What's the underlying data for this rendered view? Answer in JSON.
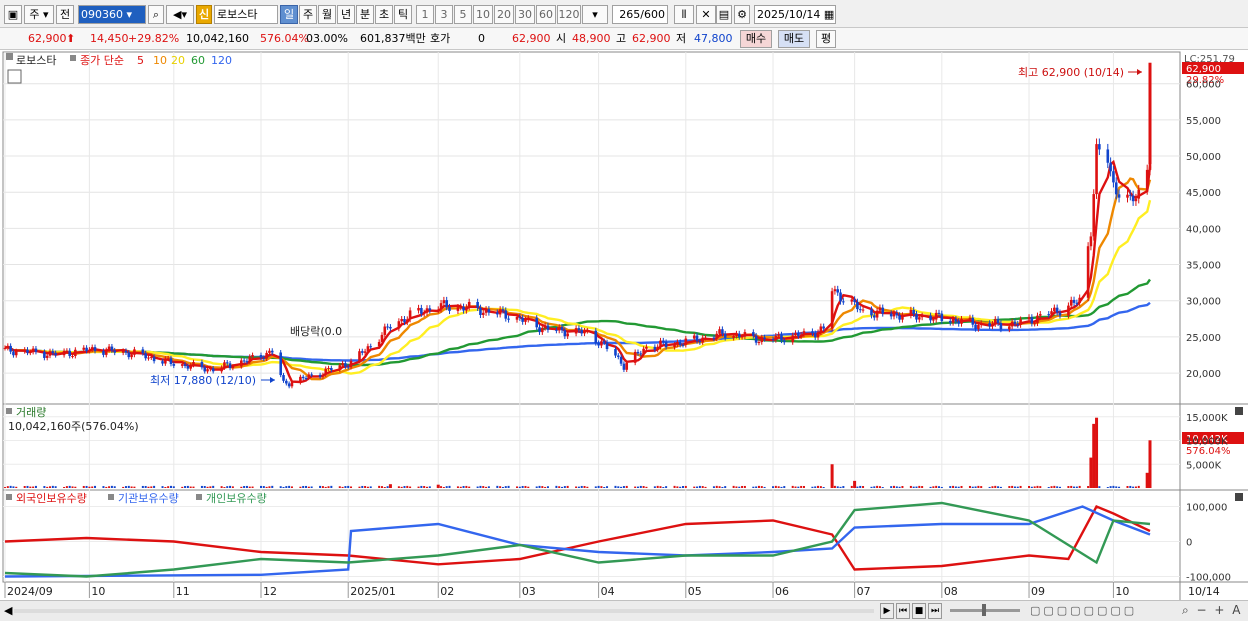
{
  "toolbar": {
    "market": "주",
    "prev_label": "전",
    "code": "090360",
    "new_badge": "신",
    "name": "로보스타",
    "periods": [
      "일",
      "주",
      "월",
      "년",
      "분",
      "초",
      "틱"
    ],
    "active_period": "일",
    "intervals": [
      "1",
      "3",
      "5",
      "10",
      "20",
      "30",
      "60",
      "120"
    ],
    "count": "265",
    "count_max": "/600",
    "date": "2025/10/14"
  },
  "quote": {
    "price": "62,900",
    "change": "14,450",
    "change_pct": "+29.82%",
    "volume": "10,042,160",
    "volume_ratio": "576.04%",
    "turnover_pct": "03.00%",
    "amount": "601,837백만",
    "hoga_label": "호가",
    "hoga_value": "0",
    "ask": "62,900",
    "open_label": "시",
    "open": "48,900",
    "high_label": "고",
    "high": "62,900",
    "low_label": "저",
    "low": "47,800",
    "buy_label": "매수",
    "sell_label": "매도",
    "avg_label": "평"
  },
  "colors": {
    "up": "#dd1111",
    "down": "#1144cc",
    "ma5": "#dd1111",
    "ma10": "#ee8800",
    "ma20": "#ffee22",
    "ma60": "#229933",
    "ma120": "#3366ee",
    "foreign": "#dd1111",
    "institution": "#3366ee",
    "individual": "#339955"
  },
  "chart_data": [
    {
      "type": "candlestick",
      "legend": {
        "stock_name": "로보스타",
        "indicator_label": "종가 단순",
        "periods": [
          "5",
          "10",
          "20",
          "60",
          "120"
        ]
      },
      "ylim": [
        16000,
        63000
      ],
      "yticks": [
        20000,
        25000,
        30000,
        35000,
        40000,
        45000,
        50000,
        55000,
        60000
      ],
      "ytick_labels": [
        "20,000",
        "25,000",
        "30,000",
        "35,000",
        "40,000",
        "45,000",
        "50,000",
        "55,000",
        "60,000"
      ],
      "xticks": [
        {
          "label": "2024/09",
          "date": "2024-09-02"
        },
        {
          "label": "10",
          "date": "2024-10-02"
        },
        {
          "label": "11",
          "date": "2024-11-01"
        },
        {
          "label": "12",
          "date": "2024-12-02"
        },
        {
          "label": "2025/01",
          "date": "2025-01-02"
        },
        {
          "label": "02",
          "date": "2025-02-03"
        },
        {
          "label": "03",
          "date": "2025-03-04"
        },
        {
          "label": "04",
          "date": "2025-04-01"
        },
        {
          "label": "05",
          "date": "2025-05-02"
        },
        {
          "label": "06",
          "date": "2025-06-02"
        },
        {
          "label": "07",
          "date": "2025-07-01"
        },
        {
          "label": "08",
          "date": "2025-08-01"
        },
        {
          "label": "09",
          "date": "2025-09-01"
        },
        {
          "label": "10",
          "date": "2025-10-01"
        },
        {
          "label": "10/14",
          "date": "2025-10-14"
        }
      ],
      "close_series": [
        {
          "date": "2024-09-02",
          "close": 23200
        },
        {
          "date": "2024-09-20",
          "close": 22600
        },
        {
          "date": "2024-10-04",
          "close": 23300
        },
        {
          "date": "2024-10-18",
          "close": 22700
        },
        {
          "date": "2024-11-01",
          "close": 21300
        },
        {
          "date": "2024-11-15",
          "close": 20500
        },
        {
          "date": "2024-11-29",
          "close": 22000
        },
        {
          "date": "2024-12-06",
          "close": 23000
        },
        {
          "date": "2024-12-10",
          "close": 18500
        },
        {
          "date": "2024-12-20",
          "close": 19600
        },
        {
          "date": "2025-01-03",
          "close": 21500
        },
        {
          "date": "2025-01-10",
          "close": 23800
        },
        {
          "date": "2025-01-17",
          "close": 26500
        },
        {
          "date": "2025-01-24",
          "close": 28000
        },
        {
          "date": "2025-02-03",
          "close": 29300
        },
        {
          "date": "2025-02-14",
          "close": 29000
        },
        {
          "date": "2025-02-28",
          "close": 28000
        },
        {
          "date": "2025-03-14",
          "close": 26000
        },
        {
          "date": "2025-03-28",
          "close": 25600
        },
        {
          "date": "2025-04-07",
          "close": 22500
        },
        {
          "date": "2025-04-10",
          "close": 21000
        },
        {
          "date": "2025-04-18",
          "close": 23600
        },
        {
          "date": "2025-05-02",
          "close": 24300
        },
        {
          "date": "2025-05-16",
          "close": 25500
        },
        {
          "date": "2025-05-30",
          "close": 24600
        },
        {
          "date": "2025-06-13",
          "close": 25300
        },
        {
          "date": "2025-06-20",
          "close": 26000
        },
        {
          "date": "2025-06-23",
          "close": 31500
        },
        {
          "date": "2025-07-04",
          "close": 28500
        },
        {
          "date": "2025-07-18",
          "close": 28000
        },
        {
          "date": "2025-08-01",
          "close": 27600
        },
        {
          "date": "2025-08-14",
          "close": 26700
        },
        {
          "date": "2025-08-28",
          "close": 26800
        },
        {
          "date": "2025-09-05",
          "close": 27800
        },
        {
          "date": "2025-09-12",
          "close": 28800
        },
        {
          "date": "2025-09-19",
          "close": 30000
        },
        {
          "date": "2025-09-23",
          "close": 40000
        },
        {
          "date": "2025-09-25",
          "close": 50500
        },
        {
          "date": "2025-09-29",
          "close": 49500
        },
        {
          "date": "2025-10-01",
          "close": 46000
        },
        {
          "date": "2025-10-07",
          "close": 43500
        },
        {
          "date": "2025-10-10",
          "close": 45000
        },
        {
          "date": "2025-10-13",
          "close": 48450
        },
        {
          "date": "2025-10-14",
          "close": 62900
        }
      ],
      "annotations": {
        "high": {
          "text": "최고 62,900 (10/14)",
          "date": "2025-10-14",
          "value": 62900
        },
        "low": {
          "text": "최저 17,880 (12/10)",
          "date": "2024-12-10",
          "value": 17880
        },
        "dividend": {
          "text": "배당락(0.0",
          "date": "2024-12-27"
        }
      },
      "right_labels": {
        "lc": "LC:251.79",
        "price": "62,900",
        "pct": "29.82%"
      }
    },
    {
      "type": "bar",
      "title": "거래량",
      "subtitle": "10,042,160주(576.04%)",
      "ylim": [
        0,
        16000000
      ],
      "yticks": [
        5000000,
        10000000,
        15000000
      ],
      "ytick_labels": [
        "5,000K",
        "10,000K",
        "15,000K"
      ],
      "bars": [
        {
          "date": "2025-01-17",
          "value": 800000,
          "dir": "up"
        },
        {
          "date": "2025-02-03",
          "value": 700000,
          "dir": "up"
        },
        {
          "date": "2025-06-23",
          "value": 5000000,
          "dir": "up"
        },
        {
          "date": "2025-07-01",
          "value": 1500000,
          "dir": "up"
        },
        {
          "date": "2025-09-23",
          "value": 6400000,
          "dir": "up"
        },
        {
          "date": "2025-09-24",
          "value": 13500000,
          "dir": "up"
        },
        {
          "date": "2025-09-25",
          "value": 14800000,
          "dir": "up"
        },
        {
          "date": "2025-10-13",
          "value": 3200000,
          "dir": "up"
        },
        {
          "date": "2025-10-14",
          "value": 10042160,
          "dir": "up"
        }
      ],
      "right_labels": {
        "value": "10,042K",
        "pct": "576.04%"
      }
    },
    {
      "type": "line",
      "legend": [
        "외국인보유수량",
        "기관보유수량",
        "개인보유수량"
      ],
      "ylim": [
        -110000,
        130000
      ],
      "yticks": [
        -100000,
        0,
        100000
      ],
      "ytick_labels": [
        "-100,000",
        "0",
        "100,000"
      ],
      "series": [
        {
          "name": "외국인보유수량",
          "points": [
            [
              "2024-09-02",
              0
            ],
            [
              "2024-10-01",
              10000
            ],
            [
              "2024-11-01",
              0
            ],
            [
              "2024-12-02",
              -30000
            ],
            [
              "2025-01-02",
              -40000
            ],
            [
              "2025-02-03",
              -65000
            ],
            [
              "2025-03-04",
              -50000
            ],
            [
              "2025-04-01",
              0
            ],
            [
              "2025-05-02",
              50000
            ],
            [
              "2025-06-02",
              60000
            ],
            [
              "2025-06-23",
              20000
            ],
            [
              "2025-07-01",
              -80000
            ],
            [
              "2025-08-01",
              -70000
            ],
            [
              "2025-09-01",
              -40000
            ],
            [
              "2025-09-15",
              -50000
            ],
            [
              "2025-09-25",
              100000
            ],
            [
              "2025-10-01",
              80000
            ],
            [
              "2025-10-14",
              30000
            ]
          ]
        },
        {
          "name": "기관보유수량",
          "points": [
            [
              "2024-09-02",
              -100000
            ],
            [
              "2024-12-02",
              -95000
            ],
            [
              "2025-01-02",
              -80000
            ],
            [
              "2025-01-03",
              30000
            ],
            [
              "2025-02-03",
              50000
            ],
            [
              "2025-03-04",
              -10000
            ],
            [
              "2025-04-01",
              -30000
            ],
            [
              "2025-05-02",
              -40000
            ],
            [
              "2025-06-02",
              -30000
            ],
            [
              "2025-06-23",
              -20000
            ],
            [
              "2025-07-01",
              40000
            ],
            [
              "2025-08-01",
              50000
            ],
            [
              "2025-09-01",
              50000
            ],
            [
              "2025-09-20",
              100000
            ],
            [
              "2025-10-01",
              60000
            ],
            [
              "2025-10-14",
              20000
            ]
          ]
        },
        {
          "name": "개인보유수량",
          "points": [
            [
              "2024-09-02",
              -90000
            ],
            [
              "2024-10-01",
              -100000
            ],
            [
              "2024-11-01",
              -80000
            ],
            [
              "2024-12-02",
              -50000
            ],
            [
              "2025-01-02",
              -60000
            ],
            [
              "2025-02-03",
              -40000
            ],
            [
              "2025-03-04",
              -10000
            ],
            [
              "2025-04-01",
              -60000
            ],
            [
              "2025-05-02",
              -40000
            ],
            [
              "2025-06-02",
              -40000
            ],
            [
              "2025-06-23",
              0
            ],
            [
              "2025-07-01",
              90000
            ],
            [
              "2025-08-01",
              110000
            ],
            [
              "2025-09-01",
              60000
            ],
            [
              "2025-09-25",
              -60000
            ],
            [
              "2025-10-01",
              60000
            ],
            [
              "2025-10-14",
              50000
            ]
          ]
        }
      ]
    }
  ],
  "statusbar": {
    "controls": [
      "▶",
      "⏮",
      "■",
      "⏭"
    ]
  }
}
